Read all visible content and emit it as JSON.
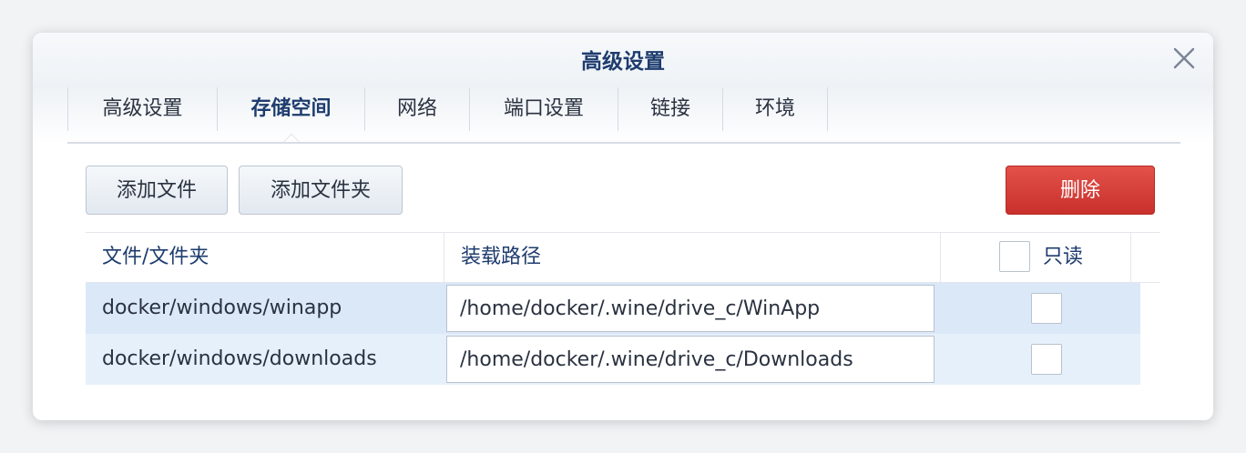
{
  "dialog": {
    "title": "高级设置",
    "close_icon": "close-icon"
  },
  "tabs": [
    {
      "label": "高级设置",
      "active": false
    },
    {
      "label": "存储空间",
      "active": true
    },
    {
      "label": "网络",
      "active": false
    },
    {
      "label": "端口设置",
      "active": false
    },
    {
      "label": "链接",
      "active": false
    },
    {
      "label": "环境",
      "active": false
    }
  ],
  "toolbar": {
    "add_file_label": "添加文件",
    "add_folder_label": "添加文件夹",
    "delete_label": "删除"
  },
  "grid": {
    "columns": {
      "file": "文件/文件夹",
      "mount_path": "装载路径",
      "readonly": "只读"
    },
    "rows": [
      {
        "file": "docker/windows/winapp",
        "mount_path": "/home/docker/.wine/drive_c/WinApp",
        "readonly": false
      },
      {
        "file": "docker/windows/downloads",
        "mount_path": "/home/docker/.wine/drive_c/Downloads",
        "readonly": false
      }
    ]
  },
  "colors": {
    "accent": "#1e3c6e",
    "danger": "#d9403a",
    "row_selected": "#dbe8f8",
    "row_alt": "#e6f0fb"
  }
}
